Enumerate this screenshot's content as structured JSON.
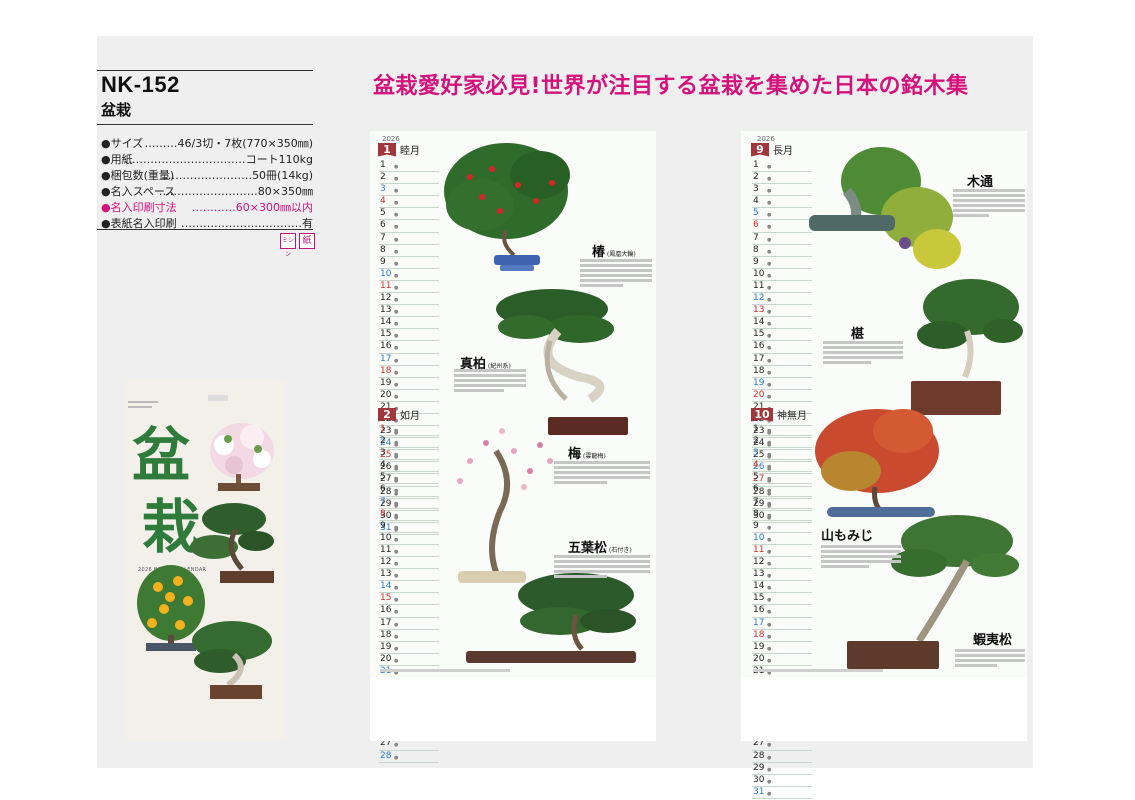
{
  "product": {
    "code": "NK-152",
    "name": "盆栽",
    "headline": "盆栽愛好家必見!世界が注目する盆栽を集めた日本の銘木集"
  },
  "specs": [
    {
      "label": "●サイズ",
      "value": "………46/3切・7枚(770×350㎜)",
      "highlight": false
    },
    {
      "label": "●用紙",
      "value": "……………………………コート110kg",
      "highlight": false
    },
    {
      "label": "●梱包数(重量)",
      "value": "……………………50冊(14kg)",
      "highlight": false
    },
    {
      "label": "●名入スペース",
      "value": "………………………80×350㎜",
      "highlight": false
    },
    {
      "label": "●名入印刷寸法",
      "value": "…………60×300㎜以内",
      "highlight": true
    },
    {
      "label": "●表紙名入印刷",
      "value": "……………………………有",
      "highlight": false
    }
  ],
  "badges": [
    "ミシン",
    "紙"
  ],
  "cover": {
    "title_line1": "盆",
    "title_line2": "栽",
    "subtitle": "2026 BONSAI CALENDAR"
  },
  "sheets": [
    {
      "year": "2026",
      "months": [
        {
          "num": "1",
          "name": "睦月",
          "days": 31
        },
        {
          "num": "2",
          "name": "如月",
          "days": 28
        }
      ],
      "trees": [
        {
          "name": "椿",
          "note": "(鳳凰大輪)"
        },
        {
          "name": "真柏",
          "note": "(紀州系)"
        },
        {
          "name": "梅",
          "note": "(雲龍梅)"
        },
        {
          "name": "五葉松",
          "note": "(石付き)"
        }
      ]
    },
    {
      "year": "2026",
      "months": [
        {
          "num": "9",
          "name": "長月",
          "days": 30
        },
        {
          "num": "10",
          "name": "神無月",
          "days": 31
        }
      ],
      "trees": [
        {
          "name": "木通",
          "note": ""
        },
        {
          "name": "椹",
          "note": ""
        },
        {
          "name": "山もみじ",
          "note": ""
        },
        {
          "name": "蝦夷松",
          "note": ""
        }
      ]
    }
  ],
  "colors": {
    "accent_pink": "#d4127c",
    "month_tag": "#a2373b",
    "cover_title_green": "#2e7b3c",
    "saturday_blue": "#2c7bc5",
    "sunday_red": "#d22c2c"
  }
}
